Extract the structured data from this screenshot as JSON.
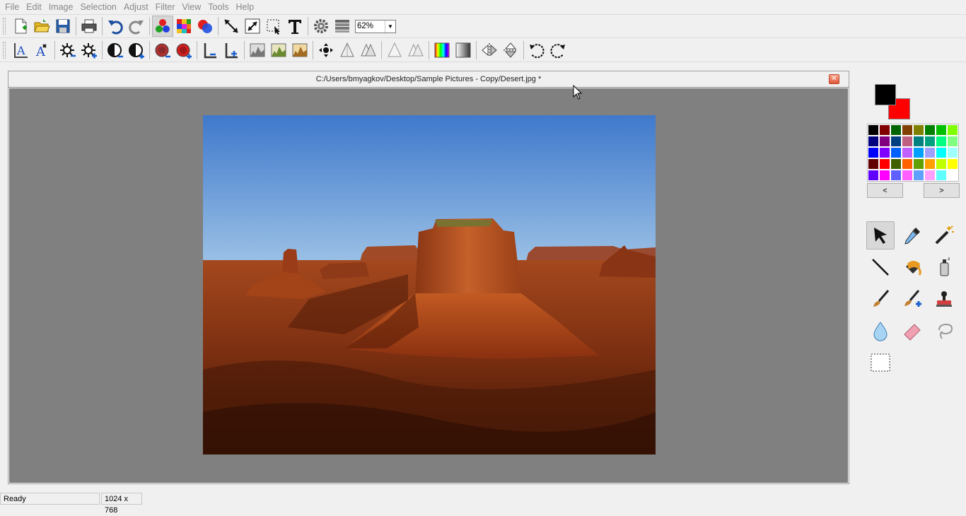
{
  "menu": [
    "File",
    "Edit",
    "Image",
    "Selection",
    "Adjust",
    "Filter",
    "View",
    "Tools",
    "Help"
  ],
  "toolbar": {
    "zoom_value": "62%"
  },
  "document": {
    "title": "C:/Users/bmyagkov/Desktop/Sample Pictures - Copy/Desert.jpg *",
    "close_glyph": "✕"
  },
  "colors": {
    "primary": "#000000",
    "secondary": "#ff0000",
    "palette": [
      "#000000",
      "#800000",
      "#006400",
      "#804000",
      "#808000",
      "#008000",
      "#00c000",
      "#80ff00",
      "#000080",
      "#800080",
      "#004080",
      "#c06080",
      "#008080",
      "#00a080",
      "#00ff80",
      "#80ff80",
      "#0000ff",
      "#8000ff",
      "#0060ff",
      "#c060ff",
      "#00a0ff",
      "#a0a0ff",
      "#00ffff",
      "#a0ffff",
      "#600000",
      "#ff0000",
      "#406000",
      "#ff6000",
      "#60a000",
      "#ffa000",
      "#c0ff00",
      "#ffff00",
      "#6000ff",
      "#ff00ff",
      "#6060ff",
      "#ff60ff",
      "#60a0ff",
      "#ffa0ff",
      "#60ffff",
      "#ffffff"
    ],
    "prev_label": "<",
    "next_label": ">"
  },
  "status": {
    "text": "Ready",
    "size": "1024 x 768"
  },
  "icons": {
    "toolbar1": [
      "new-file-icon",
      "open-folder-icon",
      "save-icon",
      "print-icon",
      "undo-icon",
      "redo-icon",
      "color-channels-icon",
      "mosaic-icon",
      "color-mix-icon",
      "move-arrow-icon",
      "resize-icon",
      "select-crop-icon",
      "text-icon",
      "settings-gear-icon",
      "layers-icon"
    ],
    "toolbar2": [
      "auto-level-icon",
      "auto-contrast-icon",
      "brightness-decrease-icon",
      "brightness-increase-icon",
      "contrast-decrease-icon",
      "contrast-increase-icon",
      "saturation-decrease-icon",
      "saturation-increase-icon",
      "levels-decrease-icon",
      "levels-increase-icon",
      "histogram-gray-icon",
      "histogram-green-icon",
      "histogram-brown-icon",
      "move-cross-icon",
      "sharpen-icon",
      "sharpen-more-icon",
      "blur-icon",
      "blur-more-icon",
      "rainbow-gradient-icon",
      "gray-gradient-icon",
      "flip-horizontal-icon",
      "flip-vertical-icon",
      "rotate-left-icon",
      "rotate-right-icon"
    ],
    "tools": [
      "pointer-tool-icon",
      "eyedropper-tool-icon",
      "magic-wand-tool-icon",
      "line-tool-icon",
      "fill-bucket-tool-icon",
      "spray-can-tool-icon",
      "brush-tool-icon",
      "clone-brush-tool-icon",
      "stamp-tool-icon",
      "water-drop-tool-icon",
      "eraser-tool-icon",
      "lasso-tool-icon",
      "rect-select-tool-icon"
    ]
  }
}
